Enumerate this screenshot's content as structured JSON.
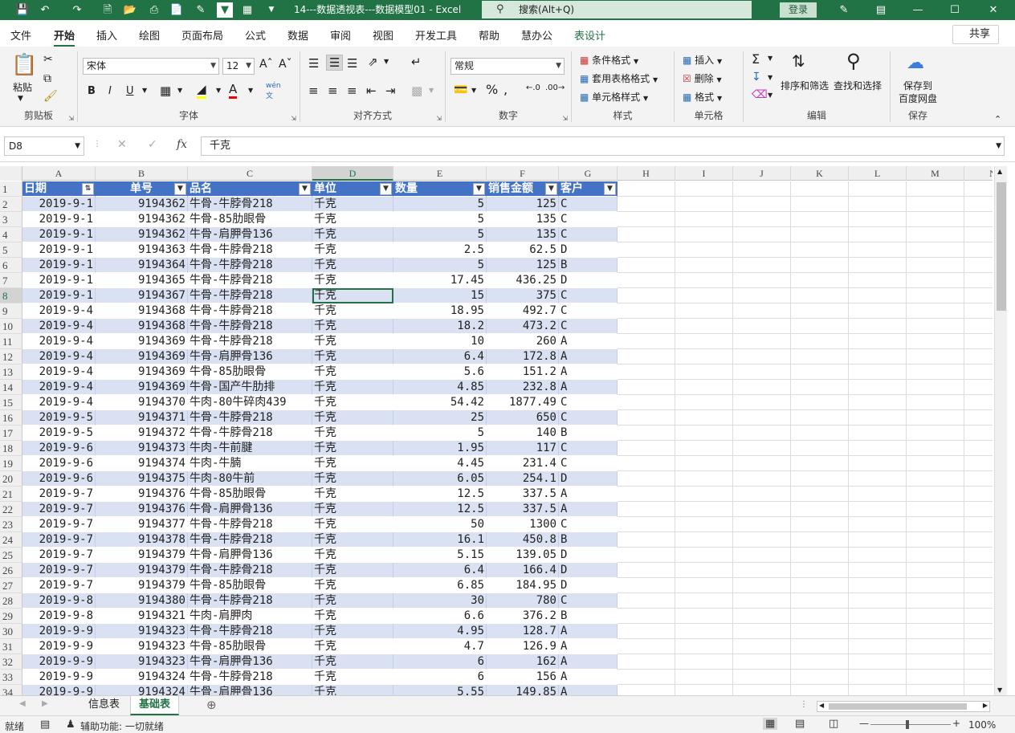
{
  "title_bar": {
    "doc_title": "14---数据透视表---数据模型01  -  Excel",
    "search_placeholder": "搜索(Alt+Q)",
    "login": "登录"
  },
  "tabs": [
    "文件",
    "开始",
    "插入",
    "绘图",
    "页面布局",
    "公式",
    "数据",
    "审阅",
    "视图",
    "开发工具",
    "帮助",
    "慧办公",
    "表设计"
  ],
  "share": "共享",
  "ribbon": {
    "clipboard": {
      "paste": "粘贴",
      "label": "剪贴板"
    },
    "font": {
      "name": "宋体",
      "size": "12",
      "label": "字体",
      "bold": "B",
      "italic": "I",
      "underline": "U"
    },
    "alignment": {
      "label": "对齐方式"
    },
    "number": {
      "format": "常规",
      "label": "数字"
    },
    "styles": {
      "conditional": "条件格式",
      "table_format": "套用表格格式",
      "cell_styles": "单元格样式",
      "label": "样式"
    },
    "cells": {
      "insert": "插入",
      "delete": "删除",
      "format": "格式",
      "label": "单元格"
    },
    "editing": {
      "sort_filter": "排序和筛选",
      "find_select": "查找和选择",
      "label": "编辑"
    },
    "save": {
      "save_to": "保存到",
      "baidu": "百度网盘",
      "label": "保存"
    }
  },
  "formula_bar": {
    "name_box": "D8",
    "formula": "千克",
    "fx": "fx"
  },
  "columns": [
    "A",
    "B",
    "C",
    "D",
    "E",
    "F",
    "G",
    "H",
    "I",
    "J",
    "K",
    "L",
    "M",
    "N"
  ],
  "selected_col": "D",
  "selected_row": 8,
  "table_headers": [
    "日期",
    "单号",
    "品名",
    "单位",
    "数量",
    "销售金额",
    "客户"
  ],
  "rows": [
    [
      "2019-9-1",
      "9194362",
      "牛骨-牛脖骨218",
      "千克",
      "5",
      "125",
      "C"
    ],
    [
      "2019-9-1",
      "9194362",
      "牛骨-85肋眼骨",
      "千克",
      "5",
      "135",
      "C"
    ],
    [
      "2019-9-1",
      "9194362",
      "牛骨-肩胛骨136",
      "千克",
      "5",
      "135",
      "C"
    ],
    [
      "2019-9-1",
      "9194363",
      "牛骨-牛脖骨218",
      "千克",
      "2.5",
      "62.5",
      "D"
    ],
    [
      "2019-9-1",
      "9194364",
      "牛骨-牛脖骨218",
      "千克",
      "5",
      "125",
      "B"
    ],
    [
      "2019-9-1",
      "9194365",
      "牛骨-牛脖骨218",
      "千克",
      "17.45",
      "436.25",
      "D"
    ],
    [
      "2019-9-1",
      "9194367",
      "牛骨-牛脖骨218",
      "千克",
      "15",
      "375",
      "C"
    ],
    [
      "2019-9-4",
      "9194368",
      "牛骨-牛脖骨218",
      "千克",
      "18.95",
      "492.7",
      "C"
    ],
    [
      "2019-9-4",
      "9194368",
      "牛骨-牛脖骨218",
      "千克",
      "18.2",
      "473.2",
      "C"
    ],
    [
      "2019-9-4",
      "9194369",
      "牛骨-牛脖骨218",
      "千克",
      "10",
      "260",
      "A"
    ],
    [
      "2019-9-4",
      "9194369",
      "牛骨-肩胛骨136",
      "千克",
      "6.4",
      "172.8",
      "A"
    ],
    [
      "2019-9-4",
      "9194369",
      "牛骨-85肋眼骨",
      "千克",
      "5.6",
      "151.2",
      "A"
    ],
    [
      "2019-9-4",
      "9194369",
      "牛骨-国产牛肋排",
      "千克",
      "4.85",
      "232.8",
      "A"
    ],
    [
      "2019-9-4",
      "9194370",
      "牛肉-80牛碎肉439",
      "千克",
      "54.42",
      "1877.49",
      "C"
    ],
    [
      "2019-9-5",
      "9194371",
      "牛骨-牛脖骨218",
      "千克",
      "25",
      "650",
      "C"
    ],
    [
      "2019-9-5",
      "9194372",
      "牛骨-牛脖骨218",
      "千克",
      "5",
      "140",
      "B"
    ],
    [
      "2019-9-6",
      "9194373",
      "牛肉-牛前腱",
      "千克",
      "1.95",
      "117",
      "C"
    ],
    [
      "2019-9-6",
      "9194374",
      "牛肉-牛腩",
      "千克",
      "4.45",
      "231.4",
      "C"
    ],
    [
      "2019-9-6",
      "9194375",
      "牛肉-80牛前",
      "千克",
      "6.05",
      "254.1",
      "D"
    ],
    [
      "2019-9-7",
      "9194376",
      "牛骨-85肋眼骨",
      "千克",
      "12.5",
      "337.5",
      "A"
    ],
    [
      "2019-9-7",
      "9194376",
      "牛骨-肩胛骨136",
      "千克",
      "12.5",
      "337.5",
      "A"
    ],
    [
      "2019-9-7",
      "9194377",
      "牛骨-牛脖骨218",
      "千克",
      "50",
      "1300",
      "C"
    ],
    [
      "2019-9-7",
      "9194378",
      "牛骨-牛脖骨218",
      "千克",
      "16.1",
      "450.8",
      "B"
    ],
    [
      "2019-9-7",
      "9194379",
      "牛骨-肩胛骨136",
      "千克",
      "5.15",
      "139.05",
      "D"
    ],
    [
      "2019-9-7",
      "9194379",
      "牛骨-牛脖骨218",
      "千克",
      "6.4",
      "166.4",
      "D"
    ],
    [
      "2019-9-7",
      "9194379",
      "牛骨-85肋眼骨",
      "千克",
      "6.85",
      "184.95",
      "D"
    ],
    [
      "2019-9-8",
      "9194380",
      "牛骨-牛脖骨218",
      "千克",
      "30",
      "780",
      "C"
    ],
    [
      "2019-9-8",
      "9194321",
      "牛肉-肩胛肉",
      "千克",
      "6.6",
      "376.2",
      "B"
    ],
    [
      "2019-9-9",
      "9194323",
      "牛骨-牛脖骨218",
      "千克",
      "4.95",
      "128.7",
      "A"
    ],
    [
      "2019-9-9",
      "9194323",
      "牛骨-85肋眼骨",
      "千克",
      "4.7",
      "126.9",
      "A"
    ],
    [
      "2019-9-9",
      "9194323",
      "牛骨-肩胛骨136",
      "千克",
      "6",
      "162",
      "A"
    ],
    [
      "2019-9-9",
      "9194324",
      "牛骨-牛脖骨218",
      "千克",
      "6",
      "156",
      "A"
    ],
    [
      "2019-9-9",
      "9194324",
      "牛骨-肩胛骨136",
      "千克",
      "5.55",
      "149.85",
      "A"
    ]
  ],
  "sheets": [
    "信息表",
    "基础表"
  ],
  "active_sheet": "基础表",
  "status": {
    "ready": "就绪",
    "accessibility": "辅助功能: 一切就绪",
    "zoom": "100%"
  },
  "colors": {
    "excel_green": "#217346",
    "table_header": "#4472c4",
    "band": "#d9e1f2"
  }
}
